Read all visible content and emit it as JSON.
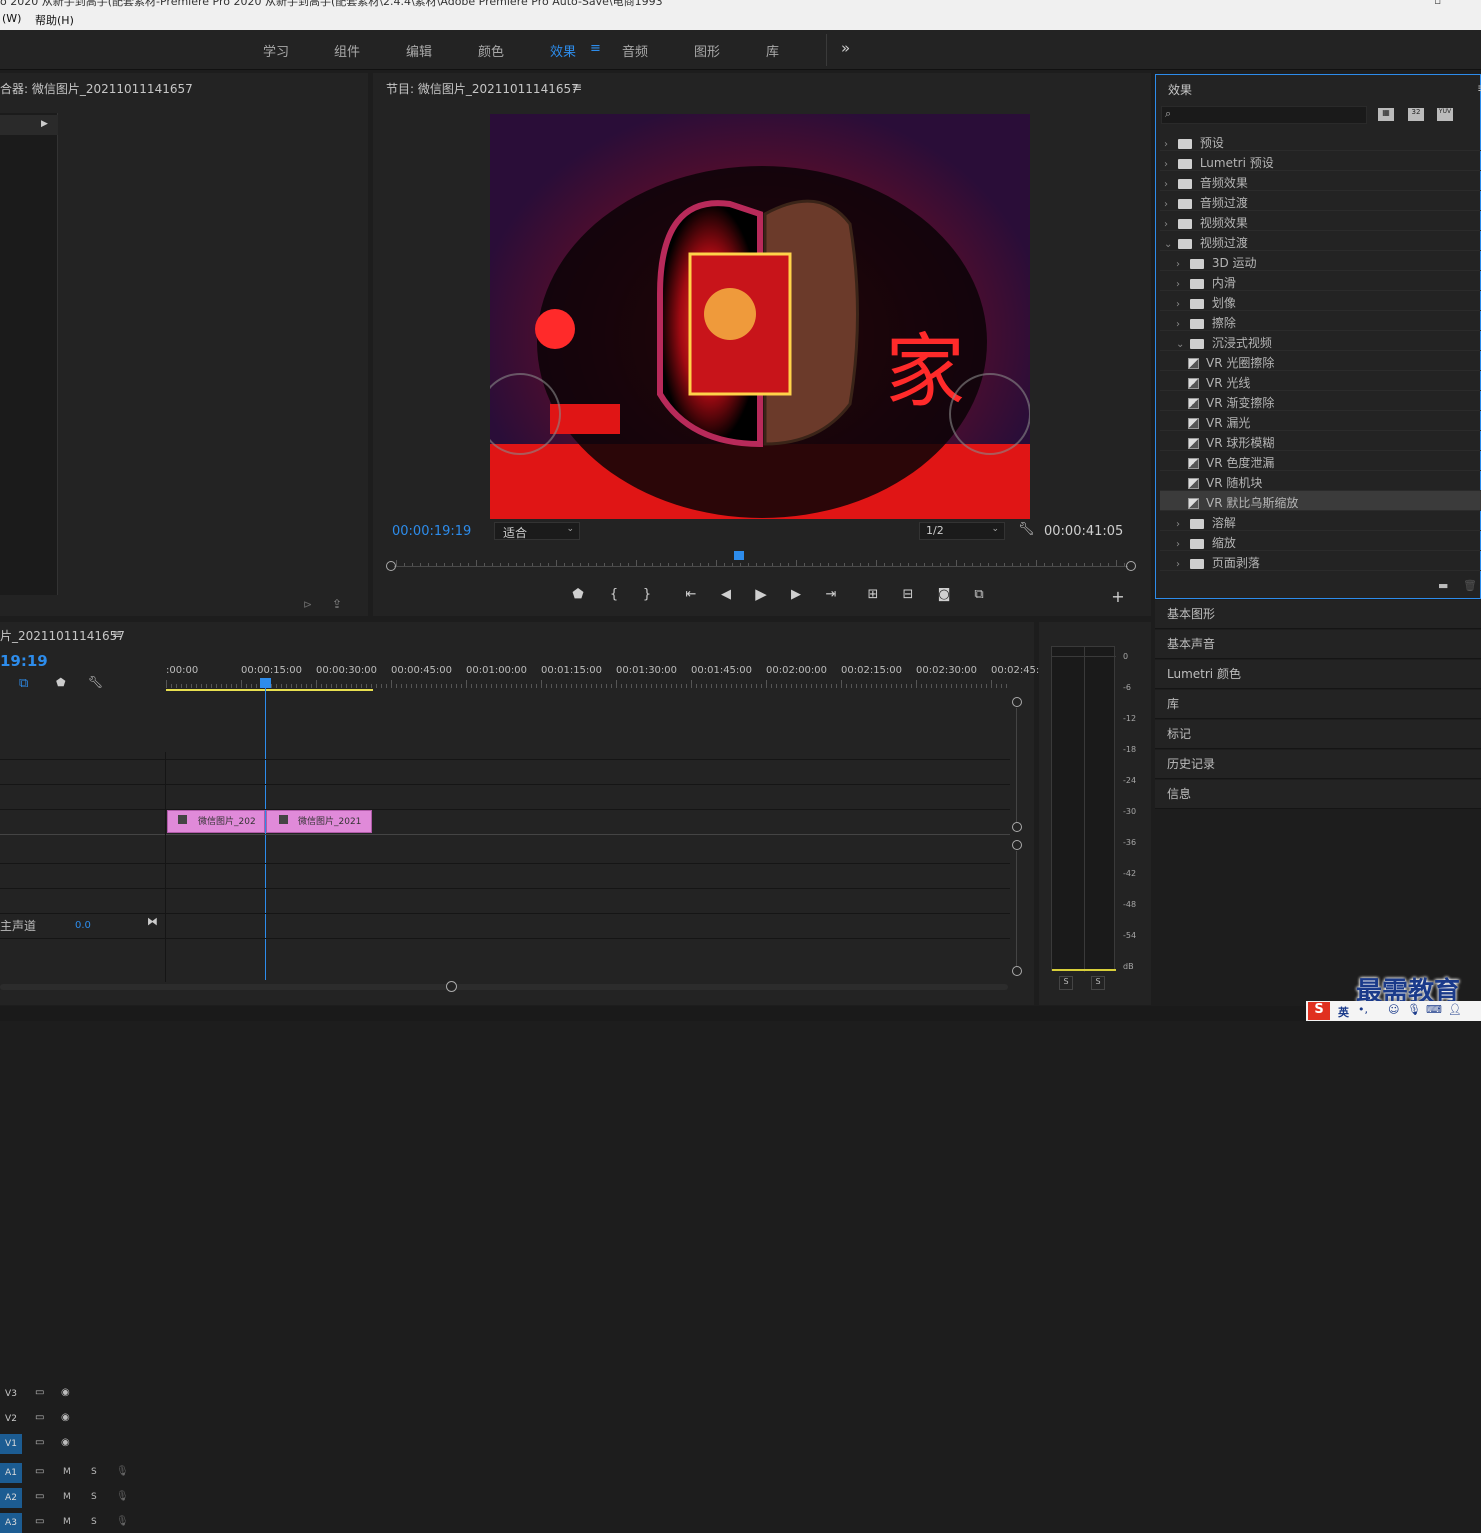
{
  "window": {
    "title": "o 2020 从新手到高手(配套素材-Premiere Pro 2020 从新手到高手(配套素材\\2.4.4\\素材\\Adobe Premiere Pro Auto-Save\\电商1993",
    "menu_window": "(W)",
    "menu_help": "帮助(H)"
  },
  "workspaces": {
    "items": [
      "学习",
      "组件",
      "编辑",
      "颜色",
      "效果",
      "音频",
      "图形",
      "库"
    ],
    "active": "效果",
    "more": "»"
  },
  "source_monitor": {
    "title": "合器: 微信图片_20211011141657"
  },
  "program_monitor": {
    "title": "节目: 微信图片_20211011141657",
    "menu_icon": "≡",
    "current_time": "00:00:19:19",
    "fit": "适合",
    "resolution": "1/2",
    "duration": "00:00:41:05",
    "playhead_fraction": 0.47
  },
  "effects_panel": {
    "title": "效果",
    "search_placeholder": "",
    "badges": [
      "32",
      "YUV"
    ],
    "items": [
      {
        "label": "预设",
        "type": "bin",
        "level": 0,
        "open": false
      },
      {
        "label": "Lumetri 预设",
        "type": "bin",
        "level": 0,
        "open": false
      },
      {
        "label": "音频效果",
        "type": "folder",
        "level": 0,
        "open": false
      },
      {
        "label": "音频过渡",
        "type": "folder",
        "level": 0,
        "open": false
      },
      {
        "label": "视频效果",
        "type": "folder",
        "level": 0,
        "open": false
      },
      {
        "label": "视频过渡",
        "type": "folder",
        "level": 0,
        "open": true
      },
      {
        "label": "3D 运动",
        "type": "folder",
        "level": 1,
        "open": false
      },
      {
        "label": "内滑",
        "type": "folder",
        "level": 1,
        "open": false
      },
      {
        "label": "划像",
        "type": "folder",
        "level": 1,
        "open": false
      },
      {
        "label": "擦除",
        "type": "folder",
        "level": 1,
        "open": false
      },
      {
        "label": "沉浸式视频",
        "type": "folder",
        "level": 1,
        "open": true
      },
      {
        "label": "VR 光圈擦除",
        "type": "fx",
        "level": 2
      },
      {
        "label": "VR 光线",
        "type": "fx",
        "level": 2
      },
      {
        "label": "VR 渐变擦除",
        "type": "fx",
        "level": 2
      },
      {
        "label": "VR 漏光",
        "type": "fx",
        "level": 2
      },
      {
        "label": "VR 球形模糊",
        "type": "fx",
        "level": 2
      },
      {
        "label": "VR 色度泄漏",
        "type": "fx",
        "level": 2
      },
      {
        "label": "VR 随机块",
        "type": "fx",
        "level": 2
      },
      {
        "label": "VR 默比乌斯缩放",
        "type": "fx",
        "level": 2,
        "selected": true
      },
      {
        "label": "溶解",
        "type": "folder",
        "level": 1,
        "open": false
      },
      {
        "label": "缩放",
        "type": "folder",
        "level": 1,
        "open": false
      },
      {
        "label": "页面剥落",
        "type": "folder",
        "level": 1,
        "open": false
      }
    ]
  },
  "side_panels": [
    "基本图形",
    "基本声音",
    "Lumetri 颜色",
    "库",
    "标记",
    "历史记录",
    "信息"
  ],
  "timeline": {
    "title": "片_20211011141657",
    "menu_icon": "≡",
    "timecode": "19:19",
    "ruler": [
      ":00:00",
      "00:00:15:00",
      "00:00:30:00",
      "00:00:45:00",
      "00:01:00:00",
      "00:01:15:00",
      "00:01:30:00",
      "00:01:45:00",
      "00:02:00:00",
      "00:02:15:00",
      "00:02:30:00",
      "00:02:45:"
    ],
    "video_tracks": [
      "V3",
      "V2",
      "V1"
    ],
    "audio_tracks": [
      "A1",
      "A2",
      "A3"
    ],
    "mute": "M",
    "solo": "S",
    "master_label": "主声道",
    "master_value": "0.0",
    "clips": [
      {
        "label": "微信图片_202",
        "track": "V1"
      },
      {
        "label": "微信图片_2021",
        "track": "V1"
      }
    ]
  },
  "audio_meter": {
    "scale": [
      "0",
      "-6",
      "-12",
      "-18",
      "-24",
      "-30",
      "-36",
      "-42",
      "-48",
      "-54",
      "dB"
    ],
    "solo_left": "S",
    "solo_right": "S"
  },
  "watermark": {
    "text": "最需教育"
  },
  "ime": {
    "lang": "英"
  },
  "colors": {
    "accent": "#2d8ceb",
    "clip": "#e08ad9",
    "panel": "#232323",
    "frame_red": "#d8141b"
  }
}
